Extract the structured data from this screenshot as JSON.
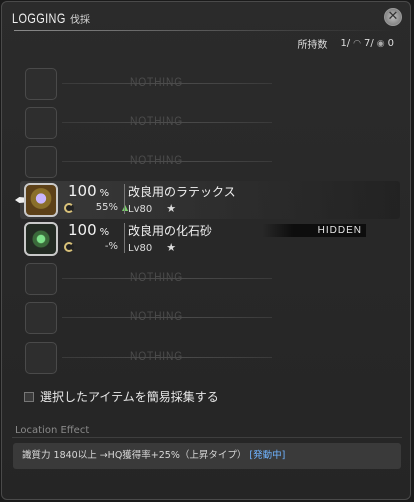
{
  "window": {
    "title": "LOGGING",
    "subtitle": "伐採",
    "close_glyph": "✕"
  },
  "inventory": {
    "label": "所持数",
    "count": "1/",
    "icon_a": "◠",
    "slots": "7/",
    "icon_b": "◉",
    "slots_b": "0"
  },
  "rows": [
    {
      "type": "empty",
      "label": "NOTHING"
    },
    {
      "type": "empty",
      "label": "NOTHING"
    },
    {
      "type": "empty",
      "label": "NOTHING"
    },
    {
      "type": "item",
      "icon": "latex-icon",
      "rate": "100",
      "rate_unit": "%",
      "hq": "55%",
      "hq_trend": "▲",
      "name": "改良用のラテックス",
      "level": "Lv80",
      "star": "★"
    },
    {
      "type": "item",
      "icon": "fossil-sand-icon",
      "rate": "100",
      "rate_unit": "%",
      "hq": "-%",
      "name": "改良用の化石砂",
      "level": "Lv80",
      "star": "★",
      "tag": "HIDDEN"
    },
    {
      "type": "empty",
      "label": "NOTHING"
    },
    {
      "type": "empty",
      "label": "NOTHING"
    },
    {
      "type": "empty",
      "label": "NOTHING"
    }
  ],
  "quick_gather_label": "選択したアイテムを簡易採集する",
  "location_effect": {
    "label": "Location Effect",
    "text": "識質力 1840以上 →HQ獲得率+25%（上昇タイプ）",
    "status": "[発動中]"
  }
}
